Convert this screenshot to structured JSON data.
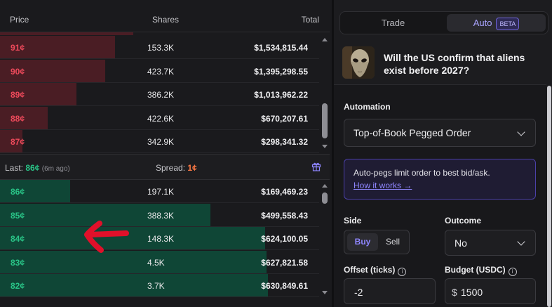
{
  "book": {
    "headers": {
      "price": "Price",
      "shares": "Shares",
      "total": "Total"
    },
    "asks": [
      {
        "price": "91¢",
        "shares": "153.3K",
        "total": "$1,534,815.44",
        "depth": 0.36
      },
      {
        "price": "90¢",
        "shares": "423.7K",
        "total": "$1,395,298.55",
        "depth": 0.33
      },
      {
        "price": "89¢",
        "shares": "386.2K",
        "total": "$1,013,962.22",
        "depth": 0.24
      },
      {
        "price": "88¢",
        "shares": "422.6K",
        "total": "$670,207.61",
        "depth": 0.15
      },
      {
        "price": "87¢",
        "shares": "342.9K",
        "total": "$298,341.32",
        "depth": 0.07
      }
    ],
    "spread": {
      "last_label": "Last:",
      "last_value": "86¢",
      "last_ago": "(6m ago)",
      "spread_label": "Spread:",
      "spread_value": "1¢"
    },
    "bids": [
      {
        "price": "86¢",
        "shares": "197.1K",
        "total": "$169,469.23",
        "depth": 0.22
      },
      {
        "price": "85¢",
        "shares": "388.3K",
        "total": "$499,558.43",
        "depth": 0.66
      },
      {
        "price": "84¢",
        "shares": "148.3K",
        "total": "$624,100.05",
        "depth": 0.83
      },
      {
        "price": "83¢",
        "shares": "4.5K",
        "total": "$627,821.58",
        "depth": 0.835
      },
      {
        "price": "82¢",
        "shares": "3.7K",
        "total": "$630,849.61",
        "depth": 0.84
      }
    ]
  },
  "panel": {
    "tabs": {
      "trade": "Trade",
      "auto": "Auto",
      "beta": "BETA"
    },
    "question": "Will the US confirm that aliens exist before 2027?",
    "automation_label": "Automation",
    "automation_value": "Top-of-Book Pegged Order",
    "note_text": "Auto-pegs limit order to best bid/ask.",
    "note_link": "How it works →",
    "side_label": "Side",
    "side_buy": "Buy",
    "side_sell": "Sell",
    "outcome_label": "Outcome",
    "outcome_value": "No",
    "offset_label": "Offset (ticks)",
    "offset_value": "-2",
    "budget_label": "Budget (USDC)",
    "budget_prefix": "$",
    "budget_value": "1500",
    "info_glyph": "i"
  },
  "colors": {
    "ask": "#ee4a5b",
    "bid": "#29c487",
    "accent": "#8f86ff",
    "spread": "#ff7a45",
    "annotation": "#e0102a"
  }
}
